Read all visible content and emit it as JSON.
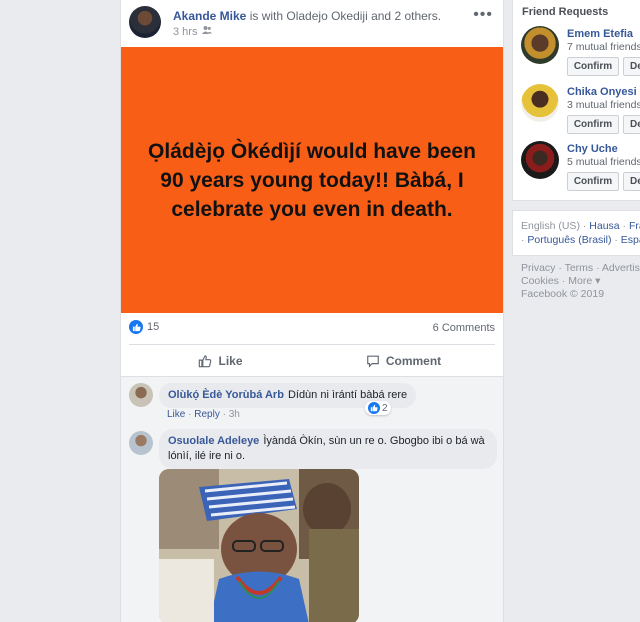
{
  "post": {
    "author": "Akande Mike",
    "with_text": "is with Oladejo Okediji and 2 others.",
    "time": "3 hrs",
    "more_icon": "ellipsis-icon",
    "banner_text": "Ọládèjọ Òkédìjí would have been 90 years young today!! Bàbá, I celebrate you even in death.",
    "banner_color": "#f95e16",
    "likes": "15",
    "comments_count": "6 Comments",
    "like_label": "Like",
    "comment_label": "Comment"
  },
  "comments": [
    {
      "name": "Olùkọ́ Èdè Yorùbá Arb",
      "text": "Dídùn ni ìrántí bàbá rere",
      "like": "Like",
      "reply": "Reply",
      "time": "3h",
      "reactions": "2"
    },
    {
      "name": "Osuolale Adeleye",
      "text": "Ìyàndá Òkín, sùn un re o. Gbogbo ibi o bá wà lónìí, ilé ire ni o."
    }
  ],
  "sidebar": {
    "title": "Friend Requests",
    "requests": [
      {
        "name": "Emem Etefia",
        "mutual": "7 mutual friends",
        "confirm": "Confirm",
        "delete": "Dele"
      },
      {
        "name": "Chika Onyesi",
        "mutual": "3 mutual friends",
        "confirm": "Confirm",
        "delete": "Dele"
      },
      {
        "name": "Chy Uche",
        "mutual": "5 mutual friends",
        "confirm": "Confirm",
        "delete": "Dele"
      }
    ],
    "languages": {
      "current": "English (US)",
      "sep1": " · ",
      "hausa": "Hausa",
      "sep2": " · ",
      "fra": "Fran",
      "sep3": " · ",
      "portugues": "Português (Brasil)",
      "sep4": " · ",
      "espanol": "Españ"
    },
    "footer": {
      "line1": "Privacy · Terms · Advertising",
      "line2": "Cookies · More ▾",
      "line3": "Facebook © 2019"
    }
  }
}
